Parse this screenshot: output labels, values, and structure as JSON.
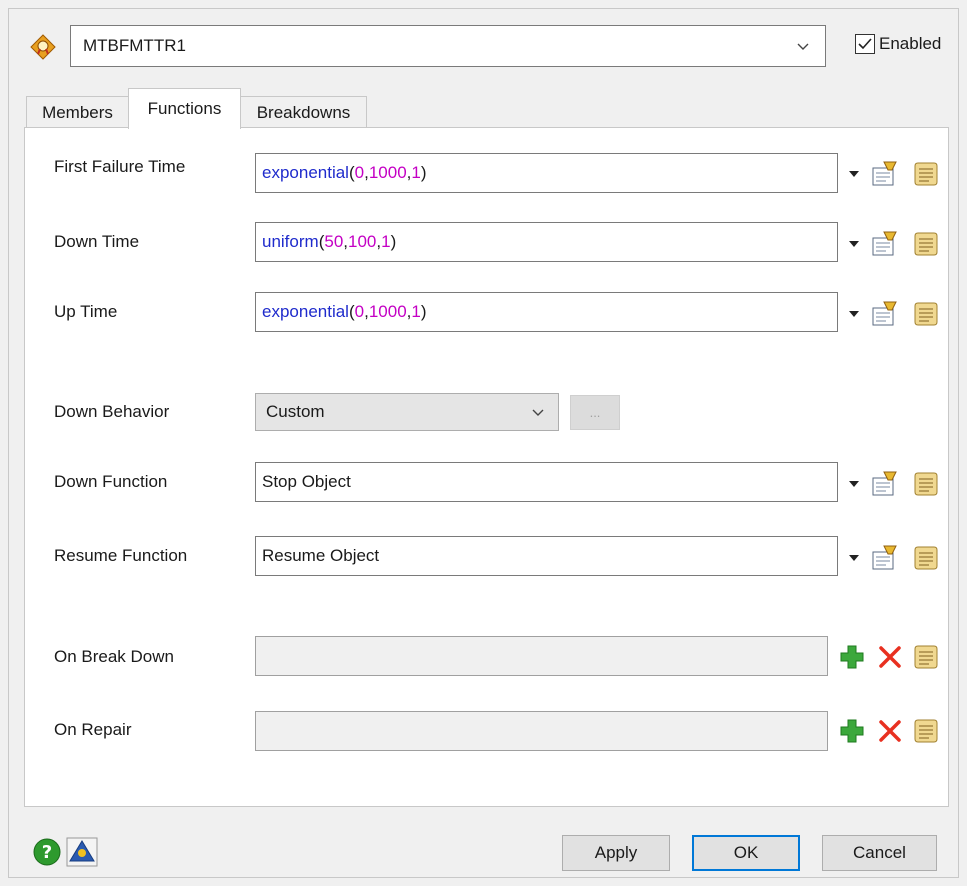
{
  "header": {
    "object_name": "MTBFMTTR1",
    "enabled_label": "Enabled",
    "enabled_checked": true,
    "object_icon": "mtbf-object-icon"
  },
  "tabs": [
    {
      "label": "Members",
      "active": false
    },
    {
      "label": "Functions",
      "active": true
    },
    {
      "label": "Breakdowns",
      "active": false
    }
  ],
  "fields": {
    "first_failure_time": {
      "label": "First Failure Time",
      "fn": "exponential",
      "args": [
        "0",
        "1000",
        "1"
      ]
    },
    "down_time": {
      "label": "Down Time",
      "fn": "uniform",
      "args": [
        "50",
        "100",
        "1"
      ]
    },
    "up_time": {
      "label": "Up Time",
      "fn": "exponential",
      "args": [
        "0",
        "1000",
        "1"
      ]
    },
    "down_behavior": {
      "label": "Down Behavior",
      "value": "Custom",
      "more_button": "..."
    },
    "down_function": {
      "label": "Down Function",
      "value": "Stop Object"
    },
    "resume_function": {
      "label": "Resume Function",
      "value": "Resume Object"
    },
    "on_break_down": {
      "label": "On Break Down",
      "value": ""
    },
    "on_repair": {
      "label": "On Repair",
      "value": ""
    }
  },
  "buttons": {
    "apply": "Apply",
    "ok": "OK",
    "cancel": "Cancel"
  },
  "colors": {
    "function_name": "#1f2bcc",
    "number": "#c400c4",
    "default_button_border": "#0078d7",
    "add_icon": "#3ca83c",
    "remove_icon": "#e83020"
  }
}
